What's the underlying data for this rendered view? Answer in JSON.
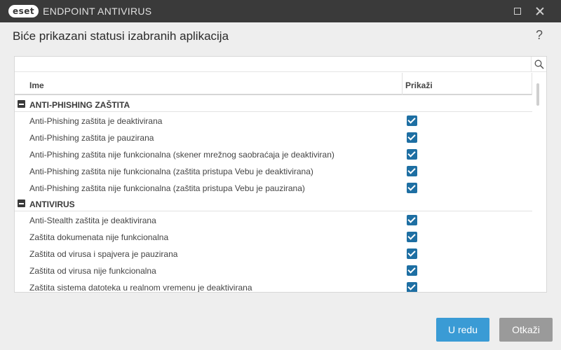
{
  "window": {
    "logo_text": "eset",
    "product_name": "ENDPOINT ANTIVIRUS"
  },
  "dialog": {
    "title": "Biće prikazani statusi izabranih aplikacija",
    "help": "?"
  },
  "search": {
    "value": "",
    "placeholder": ""
  },
  "columns": {
    "name": "Ime",
    "show": "Prikaži"
  },
  "groups": [
    {
      "label": "ANTI-PHISHING ZAŠTITA",
      "items": [
        {
          "label": "Anti-Phishing zaštita je deaktivirana",
          "checked": true
        },
        {
          "label": "Anti-Phishing zaštita je pauzirana",
          "checked": true
        },
        {
          "label": "Anti-Phishing zaštita nije funkcionalna (skener mrežnog saobraćaja je deaktiviran)",
          "checked": true
        },
        {
          "label": "Anti-Phishing zaštita nije funkcionalna (zaštita pristupa Vebu je deaktivirana)",
          "checked": true
        },
        {
          "label": "Anti-Phishing zaštita nije funkcionalna (zaštita pristupa Vebu je pauzirana)",
          "checked": true
        }
      ]
    },
    {
      "label": "ANTIVIRUS",
      "items": [
        {
          "label": "Anti-Stealth zaštita je deaktivirana",
          "checked": true
        },
        {
          "label": "Zaštita dokumenata nije funkcionalna",
          "checked": true
        },
        {
          "label": "Zaštita od virusa i spajvera je pauzirana",
          "checked": true
        },
        {
          "label": "Zaštita od virusa nije funkcionalna",
          "checked": true
        },
        {
          "label": "Zaštita sistema datoteka u realnom vremenu je deaktivirana",
          "checked": true
        }
      ]
    }
  ],
  "buttons": {
    "ok": "U redu",
    "cancel": "Otkaži"
  },
  "colors": {
    "titlebar": "#3a3a3a",
    "checkbox": "#1e6fa3",
    "ok": "#3a9bd5",
    "cancel": "#9a9a9a"
  }
}
